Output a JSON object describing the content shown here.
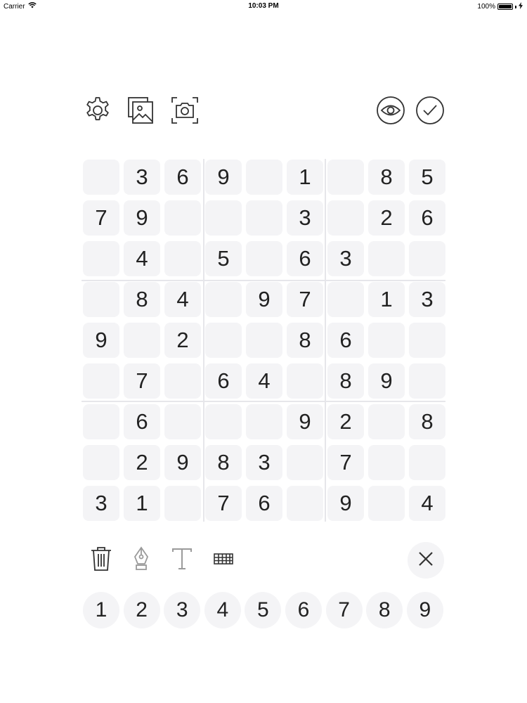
{
  "status_bar": {
    "carrier": "Carrier",
    "time": "10:03 PM",
    "battery": "100%"
  },
  "toolbar": {
    "left_icons": [
      "gear-icon",
      "gallery-icon",
      "camera-scan-icon"
    ],
    "right_icons": [
      "eye-icon",
      "check-icon"
    ]
  },
  "board": {
    "rows": [
      [
        "",
        "3",
        "6",
        "9",
        "",
        "1",
        "",
        "8",
        "5"
      ],
      [
        "7",
        "9",
        "",
        "",
        "",
        "3",
        "",
        "2",
        "6"
      ],
      [
        "",
        "4",
        "",
        "5",
        "",
        "6",
        "3",
        "",
        ""
      ],
      [
        "",
        "8",
        "4",
        "",
        "9",
        "7",
        "",
        "1",
        "3"
      ],
      [
        "9",
        "",
        "2",
        "",
        "",
        "8",
        "6",
        "",
        ""
      ],
      [
        "",
        "7",
        "",
        "6",
        "4",
        "",
        "8",
        "9",
        ""
      ],
      [
        "",
        "6",
        "",
        "",
        "",
        "9",
        "2",
        "",
        "8"
      ],
      [
        "",
        "2",
        "9",
        "8",
        "3",
        "",
        "7",
        "",
        ""
      ],
      [
        "3",
        "1",
        "",
        "7",
        "6",
        "",
        "9",
        "",
        "4"
      ]
    ]
  },
  "tools": {
    "icons": [
      "trash-icon",
      "pen-icon",
      "text-icon",
      "keyboard-icon"
    ],
    "close_icon": "close-icon"
  },
  "number_pad": [
    "1",
    "2",
    "3",
    "4",
    "5",
    "6",
    "7",
    "8",
    "9"
  ],
  "colors": {
    "cell_background": "#f4f4f6",
    "icon_stroke": "#333333",
    "muted_icon": "#9a9a9a"
  }
}
